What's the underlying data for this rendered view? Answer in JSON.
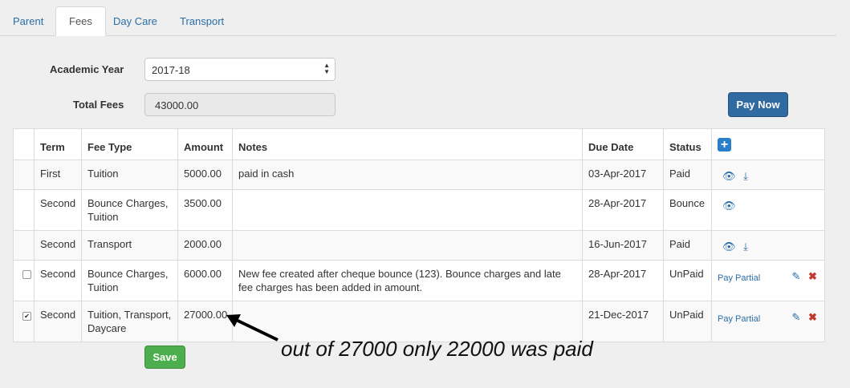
{
  "tabs": [
    {
      "label": "Parent"
    },
    {
      "label": "Fees"
    },
    {
      "label": "Day Care"
    },
    {
      "label": "Transport"
    }
  ],
  "form": {
    "academic_year_label": "Academic Year",
    "academic_year_value": "2017-18",
    "total_fees_label": "Total Fees",
    "total_fees_value": "43000.00",
    "pay_now_label": "Pay Now",
    "save_label": "Save"
  },
  "table": {
    "headers": [
      "Term",
      "Fee Type",
      "Amount",
      "Notes",
      "Due Date",
      "Status"
    ],
    "rows": [
      {
        "term": "First",
        "fee_type": "Tuition",
        "amount": "5000.00",
        "notes": "paid in cash",
        "due_date": "03-Apr-2017",
        "status": "Paid"
      },
      {
        "term": "Second",
        "fee_type": "Bounce Charges, Tuition",
        "amount": "3500.00",
        "notes": "",
        "due_date": "28-Apr-2017",
        "status": "Bounce"
      },
      {
        "term": "Second",
        "fee_type": "Transport",
        "amount": "2000.00",
        "notes": "",
        "due_date": "16-Jun-2017",
        "status": "Paid"
      },
      {
        "term": "Second",
        "fee_type": "Bounce Charges, Tuition",
        "amount": "6000.00",
        "notes": "New fee created after cheque bounce (123). Bounce charges and late fee charges has been added in amount.",
        "due_date": "28-Apr-2017",
        "status": "UnPaid",
        "pay_partial": "Pay Partial"
      },
      {
        "term": "Second",
        "fee_type": "Tuition, Transport, Daycare",
        "amount": "27000.00",
        "notes": "",
        "due_date": "21-Dec-2017",
        "status": "UnPaid",
        "pay_partial": "Pay Partial"
      }
    ]
  },
  "annotation": "out of 27000 only 22000 was paid",
  "icons": {
    "view": "eye-icon",
    "download": "download-icon",
    "edit": "edit-icon",
    "delete": "close-icon",
    "add": "plus-icon"
  },
  "colors": {
    "primary": "#2f6aa1",
    "success": "#4cae4c",
    "link": "#2a6ea6",
    "danger": "#c0392b"
  }
}
